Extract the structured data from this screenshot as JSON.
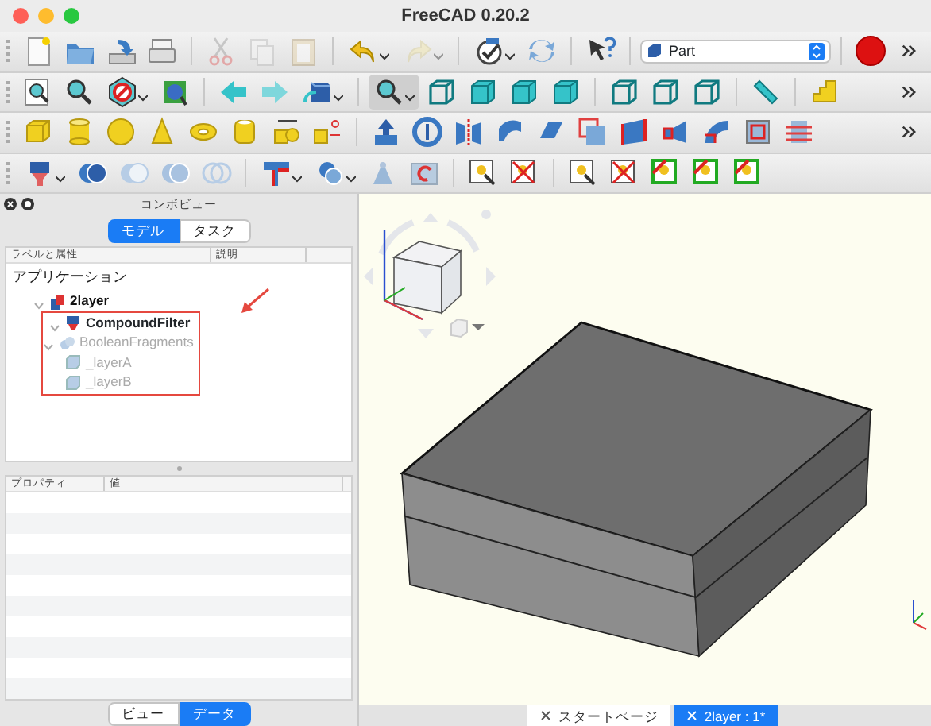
{
  "window": {
    "title": "FreeCAD 0.20.2"
  },
  "toolbar": {
    "workbench": "Part"
  },
  "combo_view": {
    "title": "コンボビュー",
    "tabs": [
      {
        "label": "モデル",
        "selected": true
      },
      {
        "label": "タスク",
        "selected": false
      }
    ],
    "tree": {
      "columns": [
        "ラベルと属性",
        "説明"
      ],
      "root": "アプリケーション",
      "items": [
        {
          "label": "2layer",
          "kind": "document",
          "expanded": true,
          "visible": true,
          "marked": false,
          "children": [
            {
              "label": "CompoundFilter",
              "kind": "filter",
              "expanded": true,
              "visible": true,
              "marked": true,
              "children": [
                {
                  "label": "BooleanFragments",
                  "kind": "fragments",
                  "expanded": true,
                  "visible": false,
                  "marked": false,
                  "children": [
                    {
                      "label": "_layerA",
                      "kind": "solid",
                      "visible": false,
                      "marked": false
                    },
                    {
                      "label": "_layerB",
                      "kind": "solid",
                      "visible": false,
                      "marked": false
                    }
                  ]
                }
              ]
            }
          ]
        }
      ]
    },
    "properties": {
      "columns": [
        "プロパティ",
        "値"
      ]
    },
    "bottom_tabs": [
      {
        "label": "ビュー",
        "selected": false
      },
      {
        "label": "データ",
        "selected": true
      }
    ]
  },
  "document_tabs": [
    {
      "label": "スタートページ",
      "selected": false
    },
    {
      "label": "2layer : 1*",
      "selected": true
    }
  ]
}
